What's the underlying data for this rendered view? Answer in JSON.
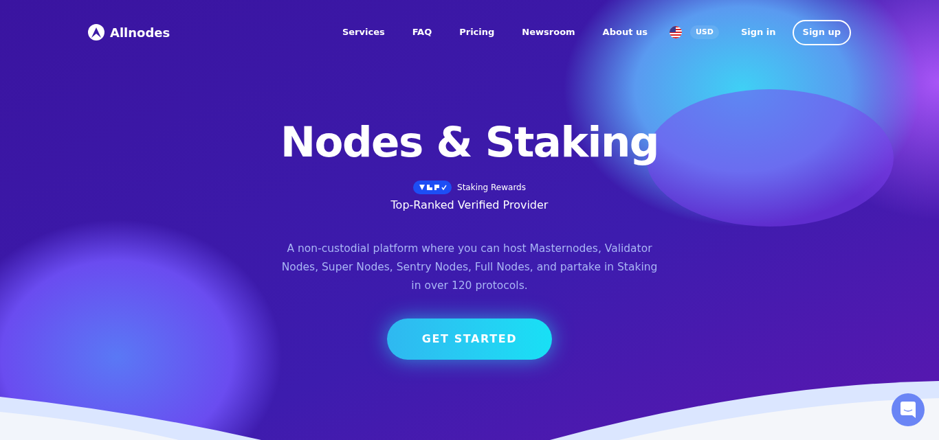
{
  "header": {
    "logo": "Allnodes",
    "nav": [
      {
        "label": "Services"
      },
      {
        "label": "FAQ"
      },
      {
        "label": "Pricing"
      },
      {
        "label": "Newsroom"
      },
      {
        "label": "About us"
      }
    ],
    "currency": "USD",
    "sign_in": "Sign in",
    "sign_up": "Sign up"
  },
  "hero": {
    "title": "Nodes & Staking",
    "badge_label": "Staking Rewards",
    "badge_subtitle": "Top-Ranked Verified Provider",
    "description": "A non-custodial platform where you can host Masternodes, Validator Nodes, Super Nodes, Sentry Nodes, Full Nodes, and partake in Staking in over 120 protocols.",
    "cta": "GET STARTED"
  }
}
